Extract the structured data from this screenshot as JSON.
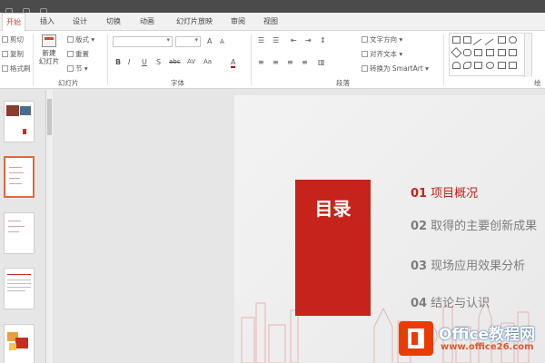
{
  "tabs": [
    {
      "label": "开始",
      "active": true
    },
    {
      "label": "插入"
    },
    {
      "label": "设计"
    },
    {
      "label": "切换"
    },
    {
      "label": "动画"
    },
    {
      "label": "幻灯片放映"
    },
    {
      "label": "审阅"
    },
    {
      "label": "视图"
    }
  ],
  "ribbon": {
    "clipboard": {
      "cut": "剪切",
      "copy": "复制",
      "format_painter": "格式刷"
    },
    "slides": {
      "new_slide": "新建",
      "new_slide_line2": "幻灯片",
      "layout": "版式",
      "reset": "重置",
      "section": "节",
      "group_label": "幻灯片"
    },
    "font": {
      "bold": "B",
      "italic": "I",
      "underline": "U",
      "shadow": "S",
      "strike": "abc",
      "spacing": "AV",
      "case": "Aa",
      "color": "A",
      "grow": "A",
      "shrink": "A",
      "group_label": "字体"
    },
    "paragraph": {
      "text_direction": "文字方向",
      "align_text": "对齐文本",
      "smartart": "转换为 SmartArt",
      "group_label": "段落"
    },
    "drawing": {
      "group_label": "绘"
    }
  },
  "thumbnails": [
    {
      "num": "",
      "selected": false
    },
    {
      "num": "",
      "selected": true
    },
    {
      "num": "",
      "selected": false
    },
    {
      "num": "",
      "selected": false
    },
    {
      "num": "",
      "selected": false
    }
  ],
  "slide": {
    "title": "目录",
    "items": [
      {
        "num": "01",
        "text": "项目概况"
      },
      {
        "num": "02",
        "text": "取得的主要创新成果"
      },
      {
        "num": "03",
        "text": "现场应用效果分析"
      },
      {
        "num": "04",
        "text": "结论与认识"
      }
    ],
    "accent_color": "#c6241b"
  },
  "watermark": {
    "line1": "Office教程网",
    "line2": "www.office26.com"
  }
}
